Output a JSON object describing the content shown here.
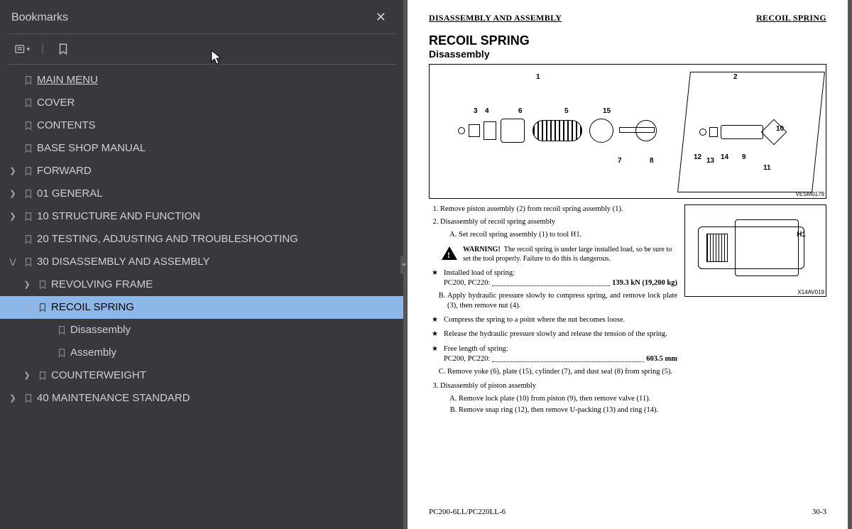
{
  "sidebar": {
    "title": "Bookmarks",
    "items": [
      {
        "label": "MAIN MENU",
        "level": 0,
        "chev": "",
        "underline": true
      },
      {
        "label": "COVER",
        "level": 0,
        "chev": ""
      },
      {
        "label": "CONTENTS",
        "level": 0,
        "chev": ""
      },
      {
        "label": "BASE SHOP MANUAL",
        "level": 0,
        "chev": ""
      },
      {
        "label": "FORWARD",
        "level": 0,
        "chev": "right"
      },
      {
        "label": "01 GENERAL",
        "level": 0,
        "chev": "right"
      },
      {
        "label": "10 STRUCTURE AND FUNCTION",
        "level": 0,
        "chev": "right"
      },
      {
        "label": "20 TESTING, ADJUSTING AND TROUBLESHOOTING",
        "level": 0,
        "chev": ""
      },
      {
        "label": "30 DISASSEMBLY AND ASSEMBLY",
        "level": 0,
        "chev": "down"
      },
      {
        "label": "REVOLVING FRAME",
        "level": 1,
        "chev": "right"
      },
      {
        "label": "RECOIL SPRING",
        "level": 1,
        "chev": "down",
        "selected": true
      },
      {
        "label": "Disassembly",
        "level": 2,
        "chev": ""
      },
      {
        "label": "Assembly",
        "level": 2,
        "chev": ""
      },
      {
        "label": "COUNTERWEIGHT",
        "level": 1,
        "chev": "right"
      },
      {
        "label": "40 MAINTENANCE STANDARD",
        "level": 0,
        "chev": "right"
      }
    ]
  },
  "page": {
    "header_left": "DISASSEMBLY AND ASSEMBLY",
    "header_right": "RECOIL SPRING",
    "title": "RECOIL SPRING",
    "subtitle": "Disassembly",
    "diag_id_main": "VESM0179",
    "diag_parts": [
      "1",
      "2",
      "3",
      "4",
      "5",
      "6",
      "7",
      "8",
      "9",
      "10",
      "11",
      "12",
      "13",
      "14",
      "15"
    ],
    "step1": "Remove piston assembly (2) from recoil spring assembly (1).",
    "step2": "Disassembly of recoil spring assembly",
    "step2A": "Set recoil spring assembly (1) to tool H1.",
    "warn_label": "WARNING!",
    "warn_text": "The recoil spring is under large installed load, so be sure to set the tool properly. Failure to do this is dangerous.",
    "star_installed": "Installed load of spring:",
    "star_installed_val_label": "PC200, PC220:",
    "star_installed_val": "139.3 kN (19,200 kg)",
    "step2B": "Apply hydraulic pressure slowly to compress spring, and remove lock plate (3), then remove nut (4).",
    "star_compress": "Compress the spring to a point where the nut becomes loose.",
    "star_release": "Release the hydraulic pressure slowly and release the tension of the spring.",
    "star_free": "Free length of spring:",
    "star_free_val_label": "PC200, PC220:",
    "star_free_val": "603.5 mm",
    "step2C": "Remove yoke (6), plate (15), cylinder (7), and dust seal (8) from spring (5).",
    "step3": "Disassembly of piston assembly",
    "step3A": "Remove lock plate (10) from piston (9), then remove valve (11).",
    "step3B": "Remove snap ring (12), then remove U-packing (13) and ring (14).",
    "diag_id_small": "X14AV019",
    "diag_small_label": "H1",
    "footer_left": "PC200-6LL/PC220LL-6",
    "footer_right": "30-3"
  }
}
